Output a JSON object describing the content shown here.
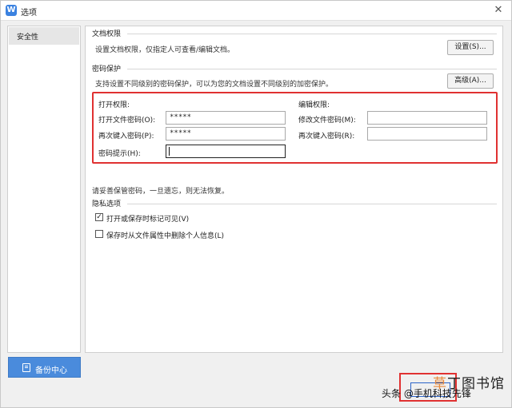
{
  "window": {
    "title": "选项",
    "app_icon": "W"
  },
  "sidebar": {
    "items": [
      {
        "label": "安全性"
      }
    ]
  },
  "backup": {
    "label": "备份中心"
  },
  "doc_permission": {
    "title": "文档权限",
    "desc": "设置文档权限，仅指定人可查看/编辑文档。",
    "button": "设置(S)..."
  },
  "password_protect": {
    "title": "密码保护",
    "desc": "支持设置不同级别的密码保护，可以为您的文档设置不同级别的加密保护。",
    "button": "高级(A)...",
    "open": {
      "heading": "打开权限:",
      "password_label": "打开文件密码(O):",
      "password_value": "*****",
      "confirm_label": "再次键入密码(P):",
      "confirm_value": "*****",
      "hint_label": "密码提示(H):",
      "hint_value": ""
    },
    "edit": {
      "heading": "编辑权限:",
      "password_label": "修改文件密码(M):",
      "password_value": "",
      "confirm_label": "再次键入密码(R):",
      "confirm_value": ""
    }
  },
  "notice": "请妥善保管密码，一旦遗忘，则无法恢复。",
  "privacy": {
    "title": "隐私选项",
    "options": [
      {
        "label": "打开或保存时标记可见(V)",
        "checked": true,
        "mark": "✓"
      },
      {
        "label": "保存时从文件属性中删除个人信息(L)",
        "checked": false,
        "mark": ""
      }
    ]
  },
  "watermark": {
    "brand_orange": "草",
    "brand_rest": "丁图书馆",
    "sub": "头条 @手机科技先锋"
  },
  "colors": {
    "accent": "#4a8bdc",
    "highlight": "#e03131"
  }
}
